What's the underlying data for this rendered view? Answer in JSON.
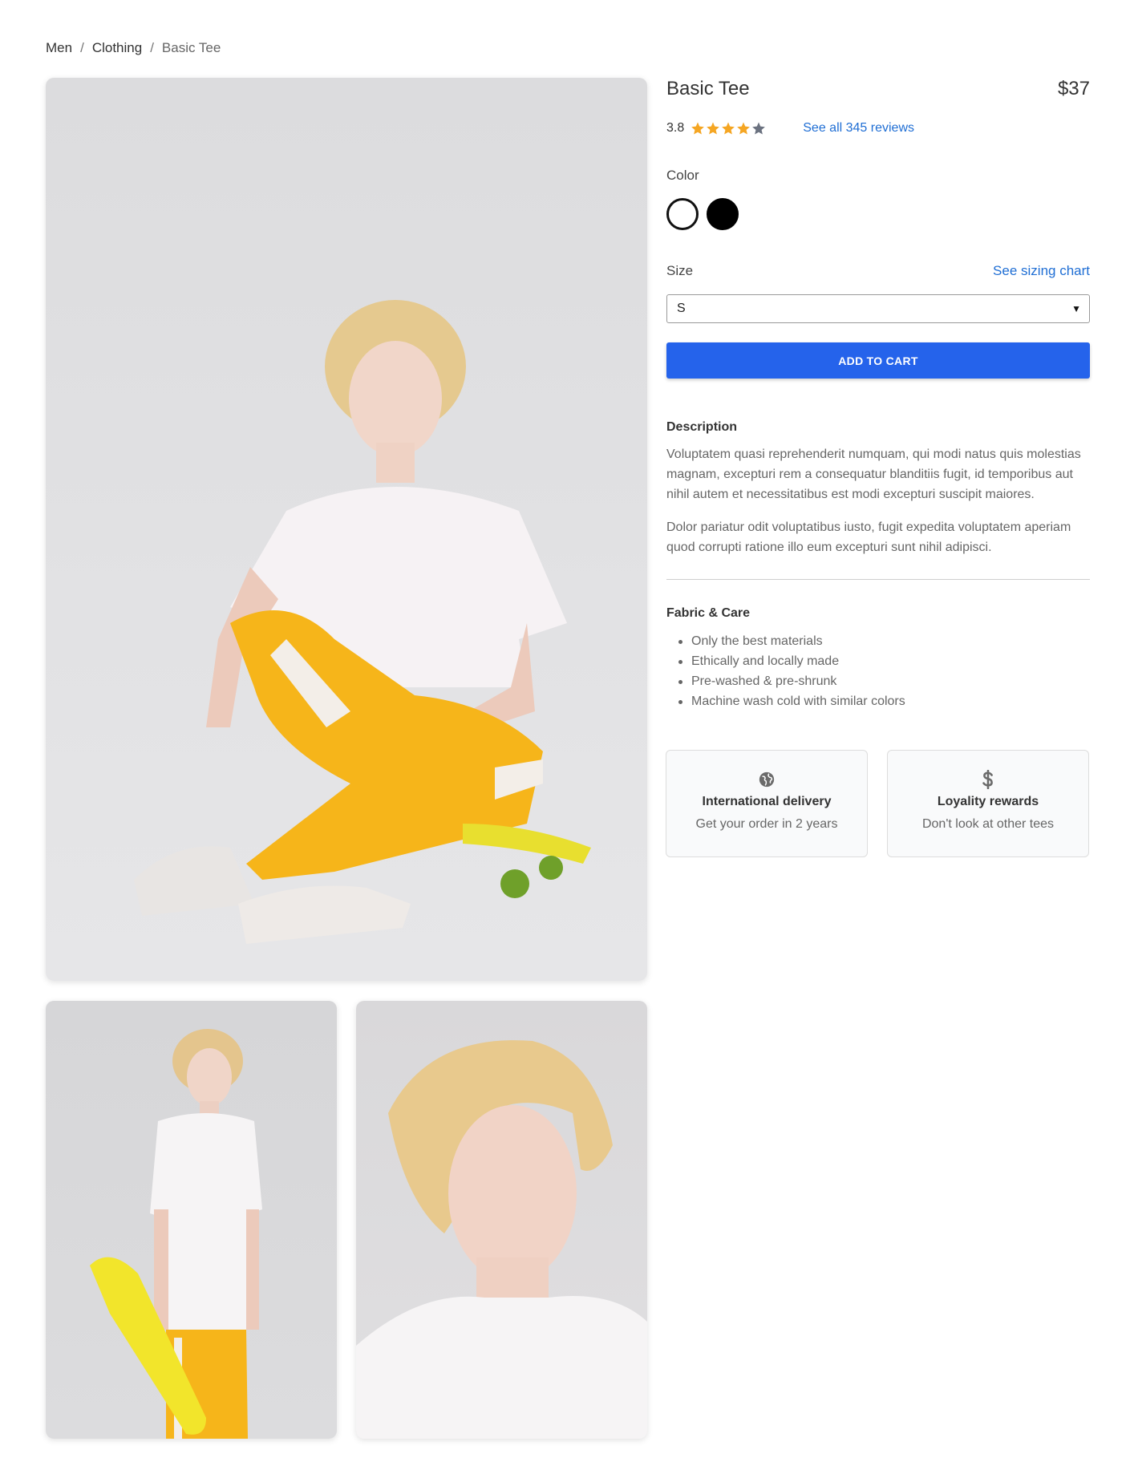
{
  "breadcrumb": {
    "items": [
      "Men",
      "Clothing",
      "Basic Tee"
    ],
    "separator": "/"
  },
  "product": {
    "name": "Basic Tee",
    "price": "$37",
    "rating": "3.8",
    "rating_value": 3.8,
    "rating_max": 5,
    "reviews_link": "See all 345 reviews"
  },
  "color": {
    "label": "Color",
    "options": [
      {
        "name": "white",
        "hex": "#ffffff",
        "selected": true
      },
      {
        "name": "black",
        "hex": "#000000",
        "selected": false
      }
    ]
  },
  "size": {
    "label": "Size",
    "sizing_link": "See sizing chart",
    "selected": "S"
  },
  "cart": {
    "button_label": "ADD TO CART",
    "button_color": "#2563eb"
  },
  "description": {
    "heading": "Description",
    "paragraphs": [
      "Voluptatem quasi reprehenderit numquam, qui modi natus quis molestias magnam, excepturi rem a consequatur blanditiis fugit, id temporibus aut nihil autem et necessitatibus est modi excepturi suscipit maiores.",
      "Dolor pariatur odit voluptatibus iusto, fugit expedita voluptatem aperiam quod corrupti ratione illo eum excepturi sunt nihil adipisci."
    ]
  },
  "fabric_care": {
    "heading": "Fabric & Care",
    "items": [
      "Only the best materials",
      "Ethically and locally made",
      "Pre-washed & pre-shrunk",
      "Machine wash cold with similar colors"
    ]
  },
  "perks": [
    {
      "icon": "globe-icon",
      "title": "International delivery",
      "text": "Get your order in 2 years"
    },
    {
      "icon": "dollar-icon",
      "title": "Loyality rewards",
      "text": "Don't look at other tees"
    }
  ],
  "gallery": {
    "images": [
      "main-photo",
      "full-body-photo",
      "portrait-photo"
    ]
  }
}
